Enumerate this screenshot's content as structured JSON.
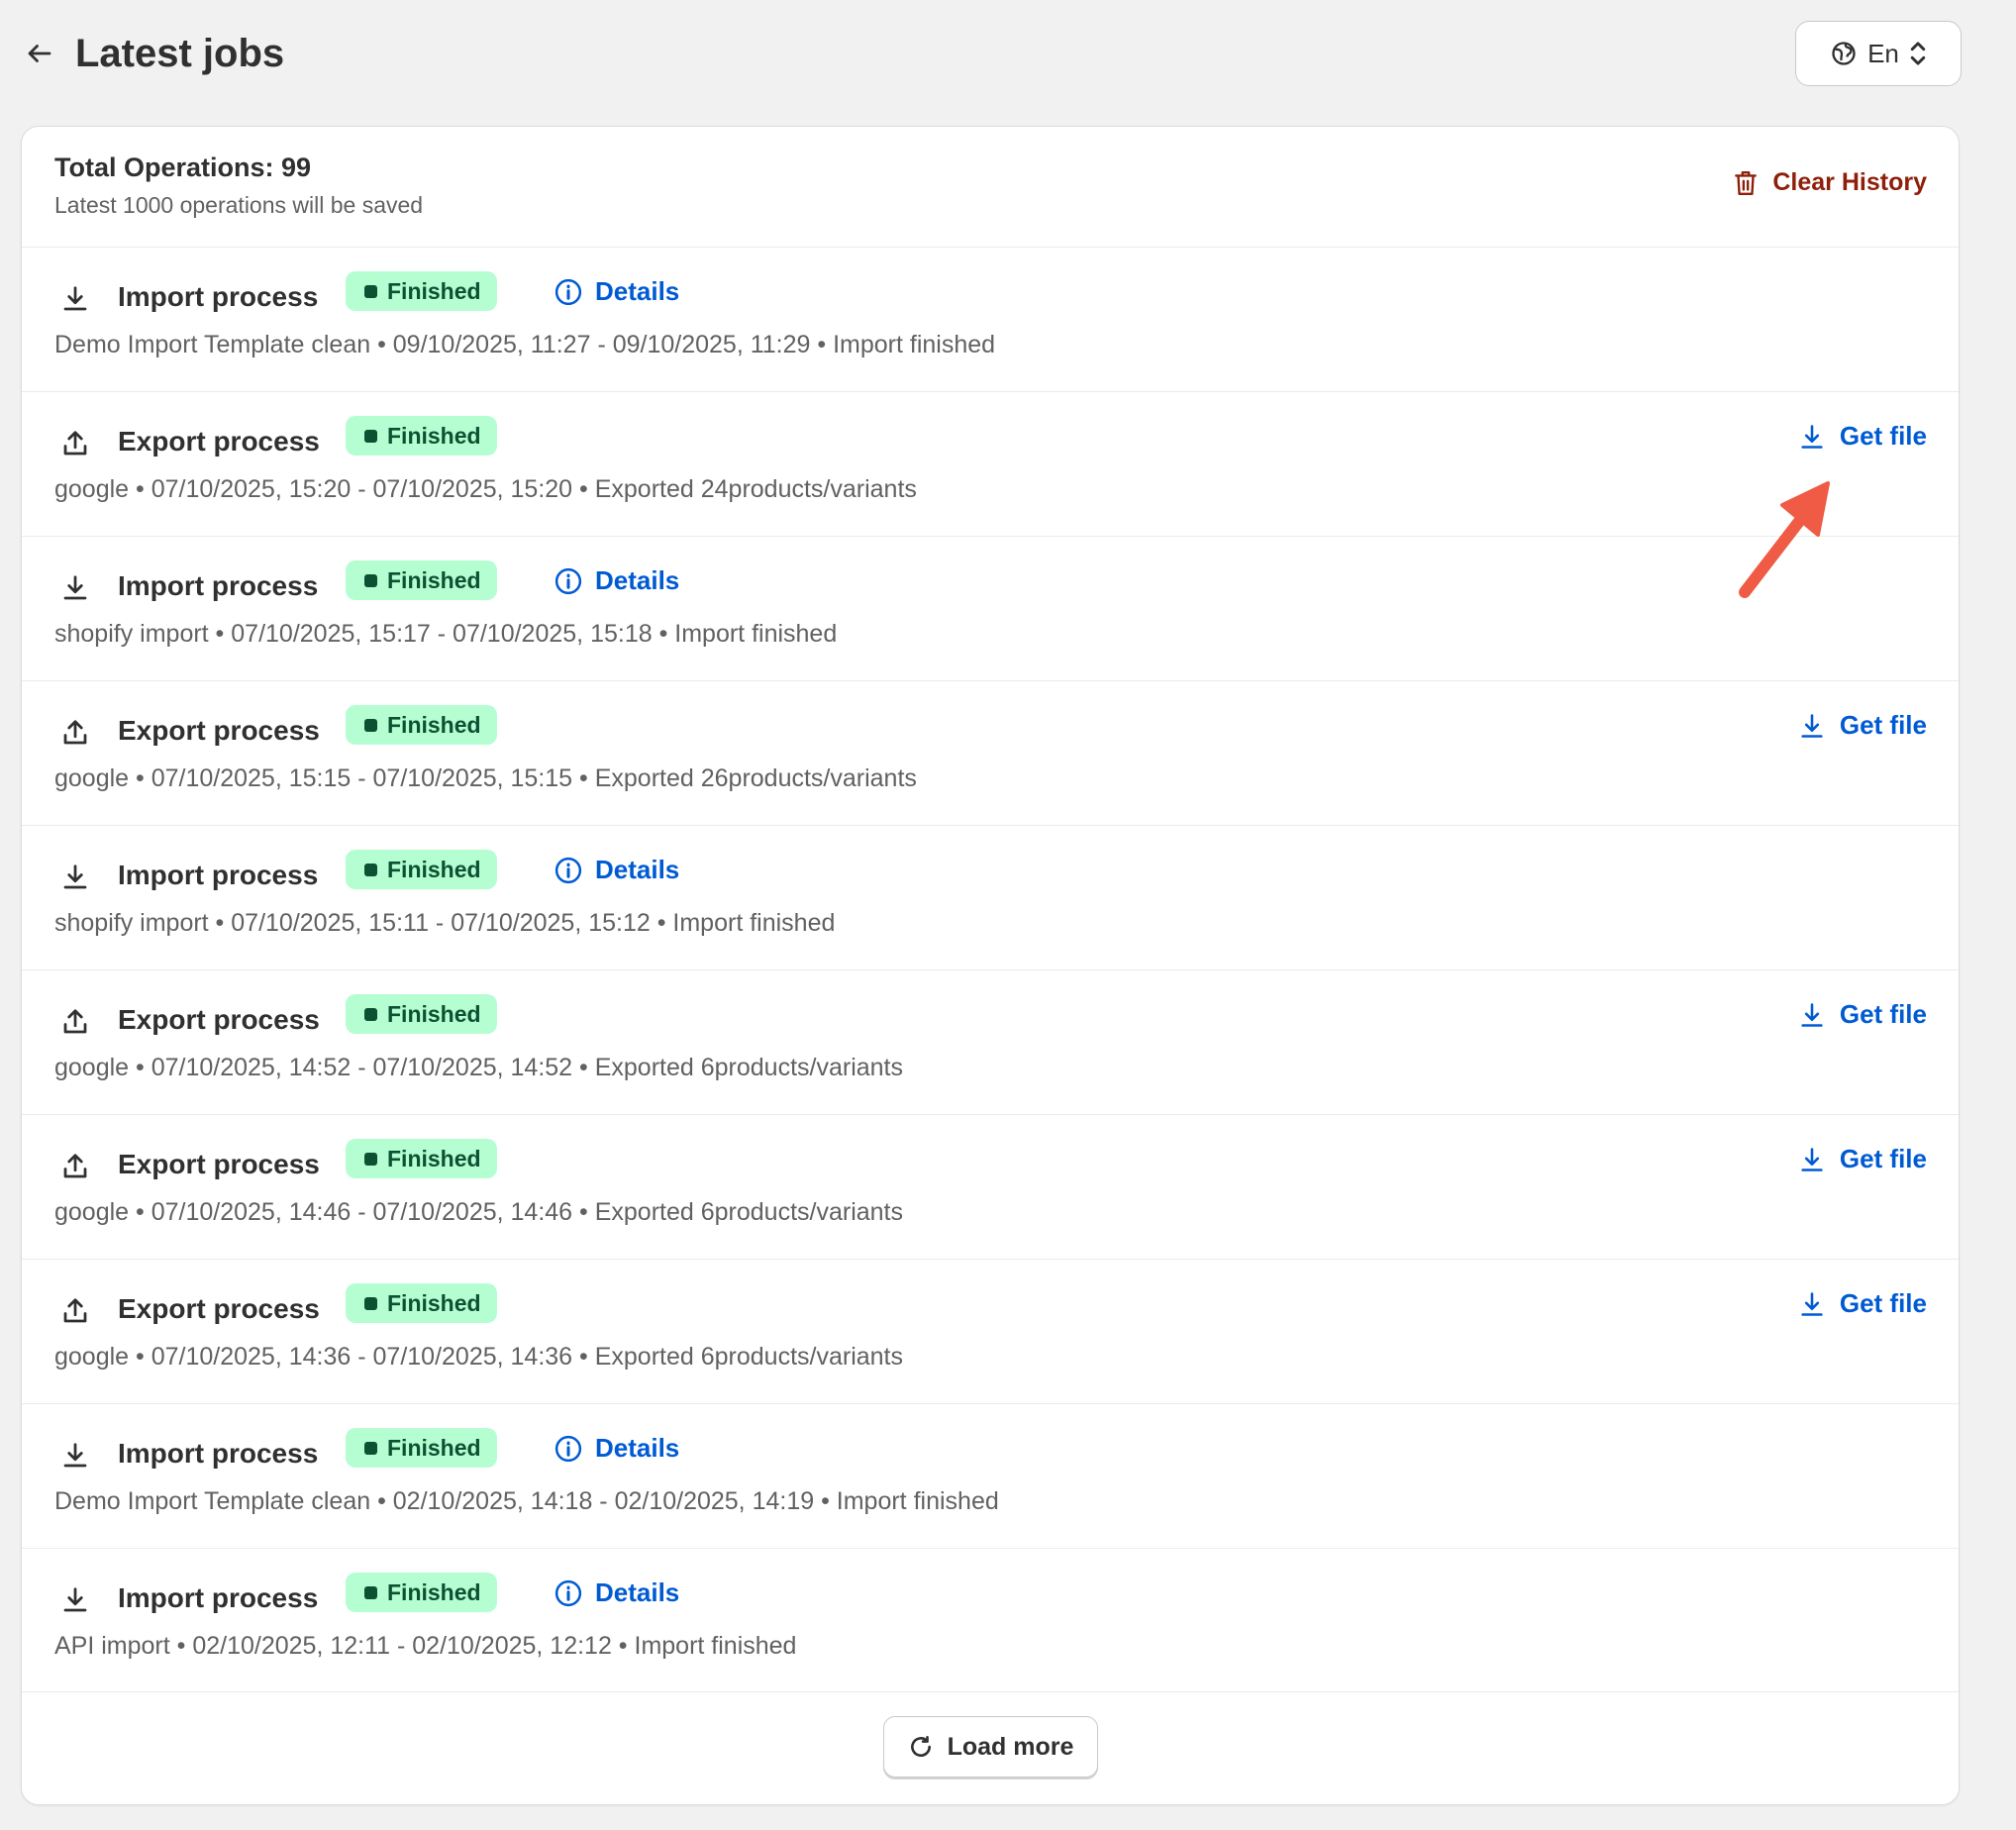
{
  "header": {
    "title": "Latest jobs",
    "language_label": "En"
  },
  "summary": {
    "total": "Total Operations: 99",
    "note": "Latest 1000 operations will be saved",
    "clear_label": "Clear History"
  },
  "jobs": [
    {
      "type": "import",
      "title": "Import process",
      "status": "Finished",
      "action": "Details",
      "meta": "Demo Import Template clean • 09/10/2025, 11:27 - 09/10/2025, 11:29 • Import finished"
    },
    {
      "type": "export",
      "title": "Export process",
      "status": "Finished",
      "action": "Get file",
      "meta": "google • 07/10/2025, 15:20 - 07/10/2025, 15:20 • Exported 24products/variants"
    },
    {
      "type": "import",
      "title": "Import process",
      "status": "Finished",
      "action": "Details",
      "meta": "shopify import • 07/10/2025, 15:17 - 07/10/2025, 15:18 • Import finished"
    },
    {
      "type": "export",
      "title": "Export process",
      "status": "Finished",
      "action": "Get file",
      "meta": "google • 07/10/2025, 15:15 - 07/10/2025, 15:15 • Exported 26products/variants"
    },
    {
      "type": "import",
      "title": "Import process",
      "status": "Finished",
      "action": "Details",
      "meta": "shopify import • 07/10/2025, 15:11 - 07/10/2025, 15:12 • Import finished"
    },
    {
      "type": "export",
      "title": "Export process",
      "status": "Finished",
      "action": "Get file",
      "meta": "google • 07/10/2025, 14:52 - 07/10/2025, 14:52 • Exported 6products/variants"
    },
    {
      "type": "export",
      "title": "Export process",
      "status": "Finished",
      "action": "Get file",
      "meta": "google • 07/10/2025, 14:46 - 07/10/2025, 14:46 • Exported 6products/variants"
    },
    {
      "type": "export",
      "title": "Export process",
      "status": "Finished",
      "action": "Get file",
      "meta": "google • 07/10/2025, 14:36 - 07/10/2025, 14:36 • Exported 6products/variants"
    },
    {
      "type": "import",
      "title": "Import process",
      "status": "Finished",
      "action": "Details",
      "meta": "Demo Import Template clean • 02/10/2025, 14:18 - 02/10/2025, 14:19 • Import finished"
    },
    {
      "type": "import",
      "title": "Import process",
      "status": "Finished",
      "action": "Details",
      "meta": "API import • 02/10/2025, 12:11 - 02/10/2025, 12:12 • Import finished"
    }
  ],
  "footer": {
    "load_more_label": "Load more"
  },
  "icons": {
    "back": "arrow-left-icon",
    "language": "globe-icon",
    "selector": "chevron-up-down-icon",
    "clear": "trash-icon",
    "import": "download-icon",
    "export": "upload-icon",
    "details": "info-icon",
    "get_file": "download-icon",
    "load_more": "refresh-icon"
  },
  "colors": {
    "background": "#f1f1f1",
    "card": "#ffffff",
    "link": "#005bd3",
    "critical": "#8e1f0b",
    "badge_bg": "#b4fed2",
    "badge_text": "#0c5132",
    "annotation_arrow": "#ef5b45"
  }
}
